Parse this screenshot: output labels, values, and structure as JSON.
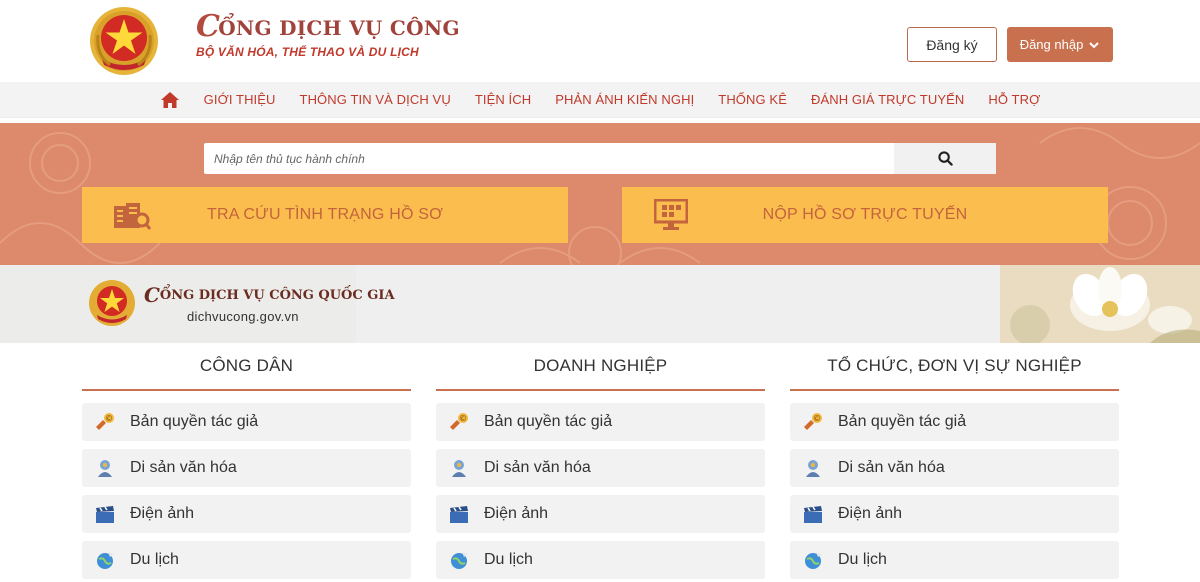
{
  "header": {
    "title": "CỔNG DỊCH VỤ CÔNG",
    "title_swash": "C",
    "title_rest": "ỔNG DỊCH VỤ CÔNG",
    "subtitle": "BỘ VĂN HÓA, THỂ THAO VÀ DU LỊCH",
    "register_label": "Đăng ký",
    "login_label": "Đăng nhập"
  },
  "nav": {
    "items": [
      "GIỚI THIỆU",
      "THÔNG TIN VÀ DỊCH VỤ",
      "TIỆN ÍCH",
      "PHẢN ÁNH KIẾN NGHỊ",
      "THỐNG KÊ",
      "ĐÁNH GIÁ TRỰC TUYẾN",
      "HỖ TRỢ"
    ]
  },
  "search": {
    "placeholder": "Nhập tên thủ tục hành chính"
  },
  "actions": {
    "lookup_label": "TRA CỨU TÌNH TRẠNG HỒ SƠ",
    "submit_label": "NỘP HỒ SƠ TRỰC TUYẾN"
  },
  "banner": {
    "title_swash": "C",
    "title_rest": "ỔNG DỊCH VỤ CÔNG QUỐC GIA",
    "url": "dichvucong.gov.vn"
  },
  "columns": [
    {
      "heading": "CÔNG DÂN",
      "items": [
        "Bản quyền tác giả",
        "Di sản văn hóa",
        "Điện ảnh",
        "Du lịch"
      ]
    },
    {
      "heading": "DOANH NGHIỆP",
      "items": [
        "Bản quyền tác giả",
        "Di sản văn hóa",
        "Điện ảnh",
        "Du lịch"
      ]
    },
    {
      "heading": "TỔ CHỨC, ĐƠN VỊ SỰ NGHIỆP",
      "items": [
        "Bản quyền tác giả",
        "Di sản văn hóa",
        "Điện ảnh",
        "Du lịch"
      ]
    }
  ],
  "icons": {
    "home": "home-icon",
    "search": "search-icon",
    "lookup": "document-search-icon",
    "submit": "monitor-grid-icon",
    "copyright": "copyright-hand-icon",
    "heritage": "heritage-icon",
    "film": "clapperboard-icon",
    "travel": "globe-plane-icon"
  },
  "colors": {
    "brand": "#a0433a",
    "accent": "#c9714e",
    "hero": "#dc8a6b",
    "action": "#fcbd4f",
    "action_text": "#c2643c"
  }
}
